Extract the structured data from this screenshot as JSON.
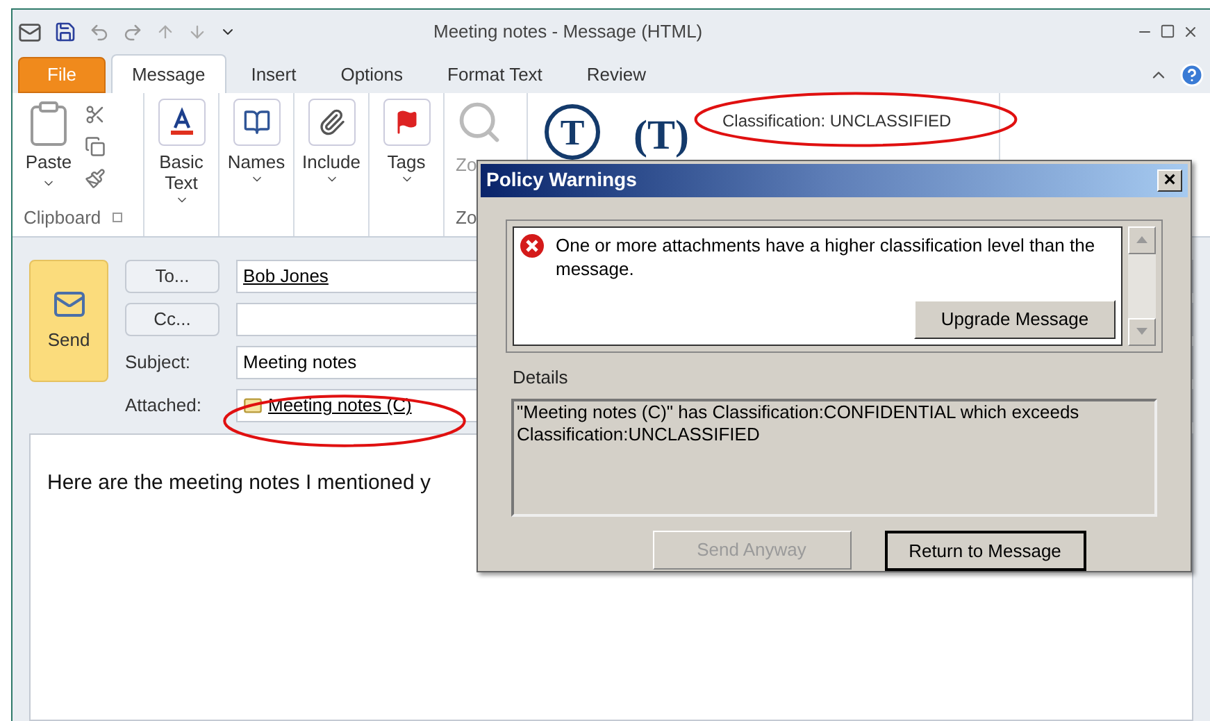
{
  "window": {
    "title": "Meeting notes - Message (HTML)"
  },
  "tabs": [
    {
      "label": "File",
      "kind": "file",
      "selected": false
    },
    {
      "label": "Message",
      "kind": "normal",
      "selected": true
    },
    {
      "label": "Insert",
      "kind": "normal",
      "selected": false
    },
    {
      "label": "Options",
      "kind": "normal",
      "selected": false
    },
    {
      "label": "Format Text",
      "kind": "normal",
      "selected": false
    },
    {
      "label": "Review",
      "kind": "normal",
      "selected": false
    }
  ],
  "ribbon": {
    "groups": [
      {
        "label": "Clipboard",
        "kind": "clipboard",
        "button": "Paste"
      },
      {
        "kind": "basic",
        "button": "Basic Text"
      },
      {
        "kind": "names",
        "button": "Names"
      },
      {
        "kind": "include",
        "button": "Include"
      },
      {
        "kind": "tags",
        "button": "Tags"
      },
      {
        "label": "Zo",
        "kind": "zoom",
        "button": "Zo"
      }
    ],
    "logos": [
      {
        "text": "T",
        "kind": "circled"
      },
      {
        "text": "(T)",
        "kind": "plain"
      }
    ],
    "classification": "Classification:  UNCLASSIFIED"
  },
  "header": {
    "send": "Send",
    "to_button": "To...",
    "to_value": "Bob Jones",
    "cc_button": "Cc...",
    "subject_label": "Subject:",
    "subject_value": "Meeting notes",
    "attached_label": "Attached:",
    "attachment": "Meeting notes (C)"
  },
  "body": {
    "text": "Here are the meeting notes I mentioned y"
  },
  "dialog": {
    "title": "Policy Warnings",
    "close": "×",
    "message": "One or more attachments have a higher classification level than the message.",
    "upgrade_button": "Upgrade Message",
    "details_label": "Details",
    "details": "\"Meeting notes (C)\" has Classification:CONFIDENTIAL which exceeds Classification:UNCLASSIFIED",
    "buttons": [
      {
        "label": "Send Anyway",
        "disabled": true
      },
      {
        "label": "Return to Message",
        "disabled": false
      }
    ]
  }
}
